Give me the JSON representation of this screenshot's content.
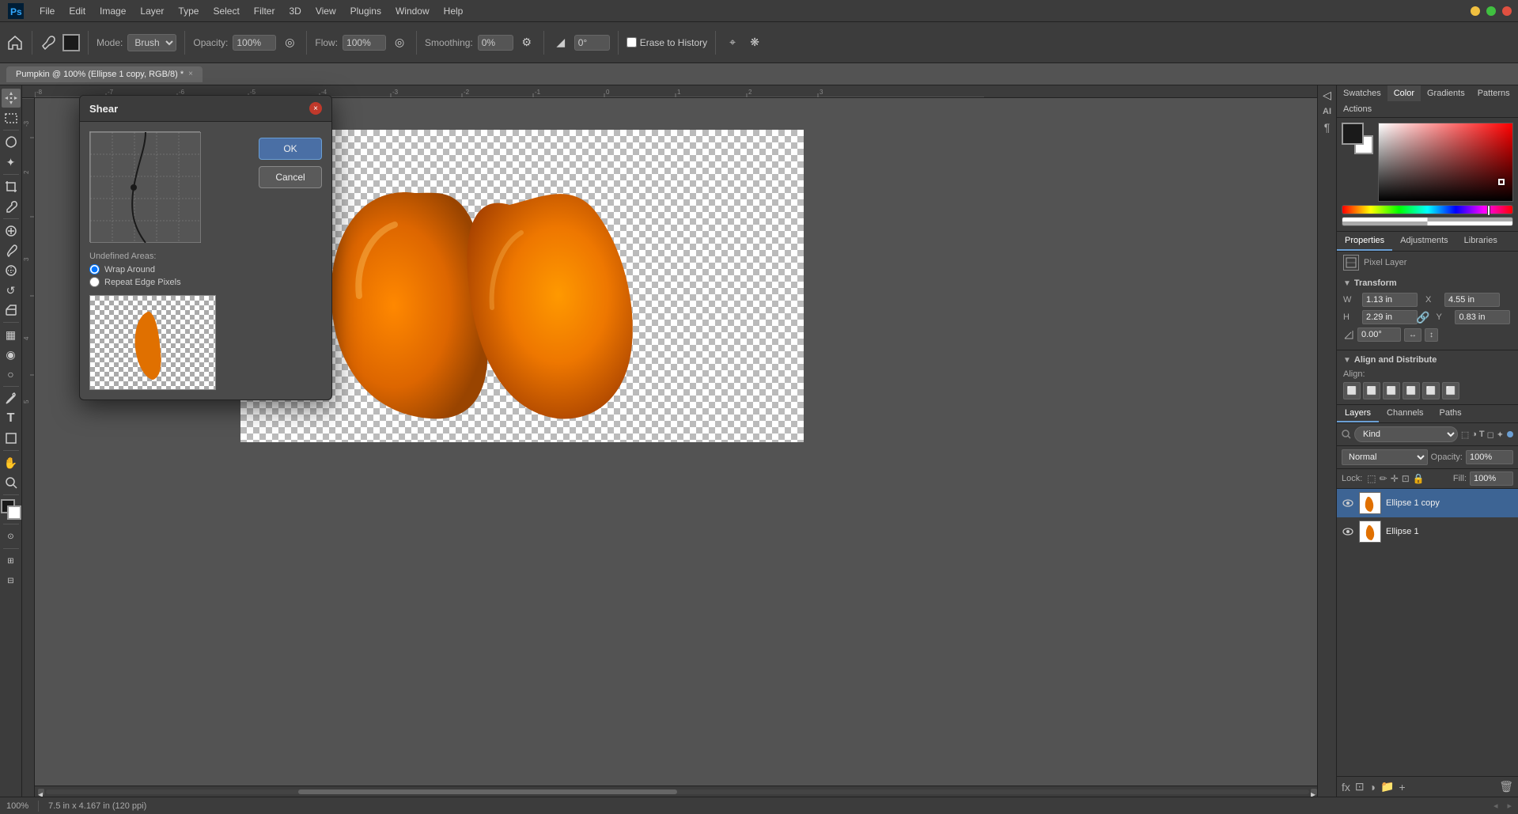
{
  "app": {
    "title": "Adobe Photoshop"
  },
  "menu": {
    "items": [
      "PS",
      "File",
      "Edit",
      "Image",
      "Layer",
      "Type",
      "Select",
      "Filter",
      "3D",
      "View",
      "Plugins",
      "Window",
      "Help"
    ]
  },
  "toolbar": {
    "mode_label": "Mode:",
    "mode_value": "Brush",
    "opacity_label": "Opacity:",
    "opacity_value": "100%",
    "flow_label": "Flow:",
    "flow_value": "100%",
    "smoothing_label": "Smoothing:",
    "smoothing_value": "0%",
    "angle_value": "0°",
    "erase_to_history": "Erase to History"
  },
  "tab": {
    "label": "Pumpkin @ 100% (Ellipse 1 copy, RGB/8) *",
    "close": "×"
  },
  "shear_dialog": {
    "title": "Shear",
    "close": "×",
    "ok": "OK",
    "cancel": "Cancel",
    "undefined_areas_label": "Undefined Areas:",
    "wrap_around": "Wrap Around",
    "repeat_edge": "Repeat Edge Pixels"
  },
  "right_panel": {
    "top_tabs": [
      "Swatches",
      "Color",
      "Gradients",
      "Patterns",
      "Actions"
    ],
    "active_tab": "Color"
  },
  "properties": {
    "title": "Properties",
    "adjustments": "Adjustments",
    "libraries": "Libraries",
    "pixel_layer": "Pixel Layer",
    "transform_title": "Transform",
    "w_label": "W",
    "w_value": "1.13 in",
    "h_label": "H",
    "h_value": "2.29 in",
    "x_label": "X",
    "x_value": "4.55 in",
    "y_label": "Y",
    "y_value": "0.83 in",
    "angle_value": "0.00°",
    "align_distribute": "Align and Distribute",
    "align_label": "Align:"
  },
  "layers_panel": {
    "tabs": [
      "Layers",
      "Channels",
      "Paths"
    ],
    "active_tab": "Layers",
    "search_placeholder": "Kind",
    "mode": "Normal",
    "opacity": "100%",
    "fill_label": "Fill:",
    "fill_value": "100%",
    "lock_label": "Lock:",
    "layers": [
      {
        "name": "Ellipse 1 copy",
        "selected": true,
        "visible": true
      },
      {
        "name": "Ellipse 1",
        "selected": false,
        "visible": true
      }
    ]
  },
  "status_bar": {
    "zoom": "100%",
    "size_info": "7.5 in x 4.167 in (120 ppi)"
  },
  "icons": {
    "move": "✛",
    "marquee_rect": "⬚",
    "lasso": "⌖",
    "magic_wand": "✦",
    "crop": "⊡",
    "eyedropper": "✒",
    "healing": "✚",
    "brush": "✏",
    "clone": "⊕",
    "history": "↺",
    "eraser": "◻",
    "gradient": "▦",
    "blur": "◉",
    "dodge": "○",
    "pen": "✒",
    "text": "T",
    "shape": "◻",
    "hand": "✋",
    "zoom": "⊕",
    "eye": "👁"
  }
}
